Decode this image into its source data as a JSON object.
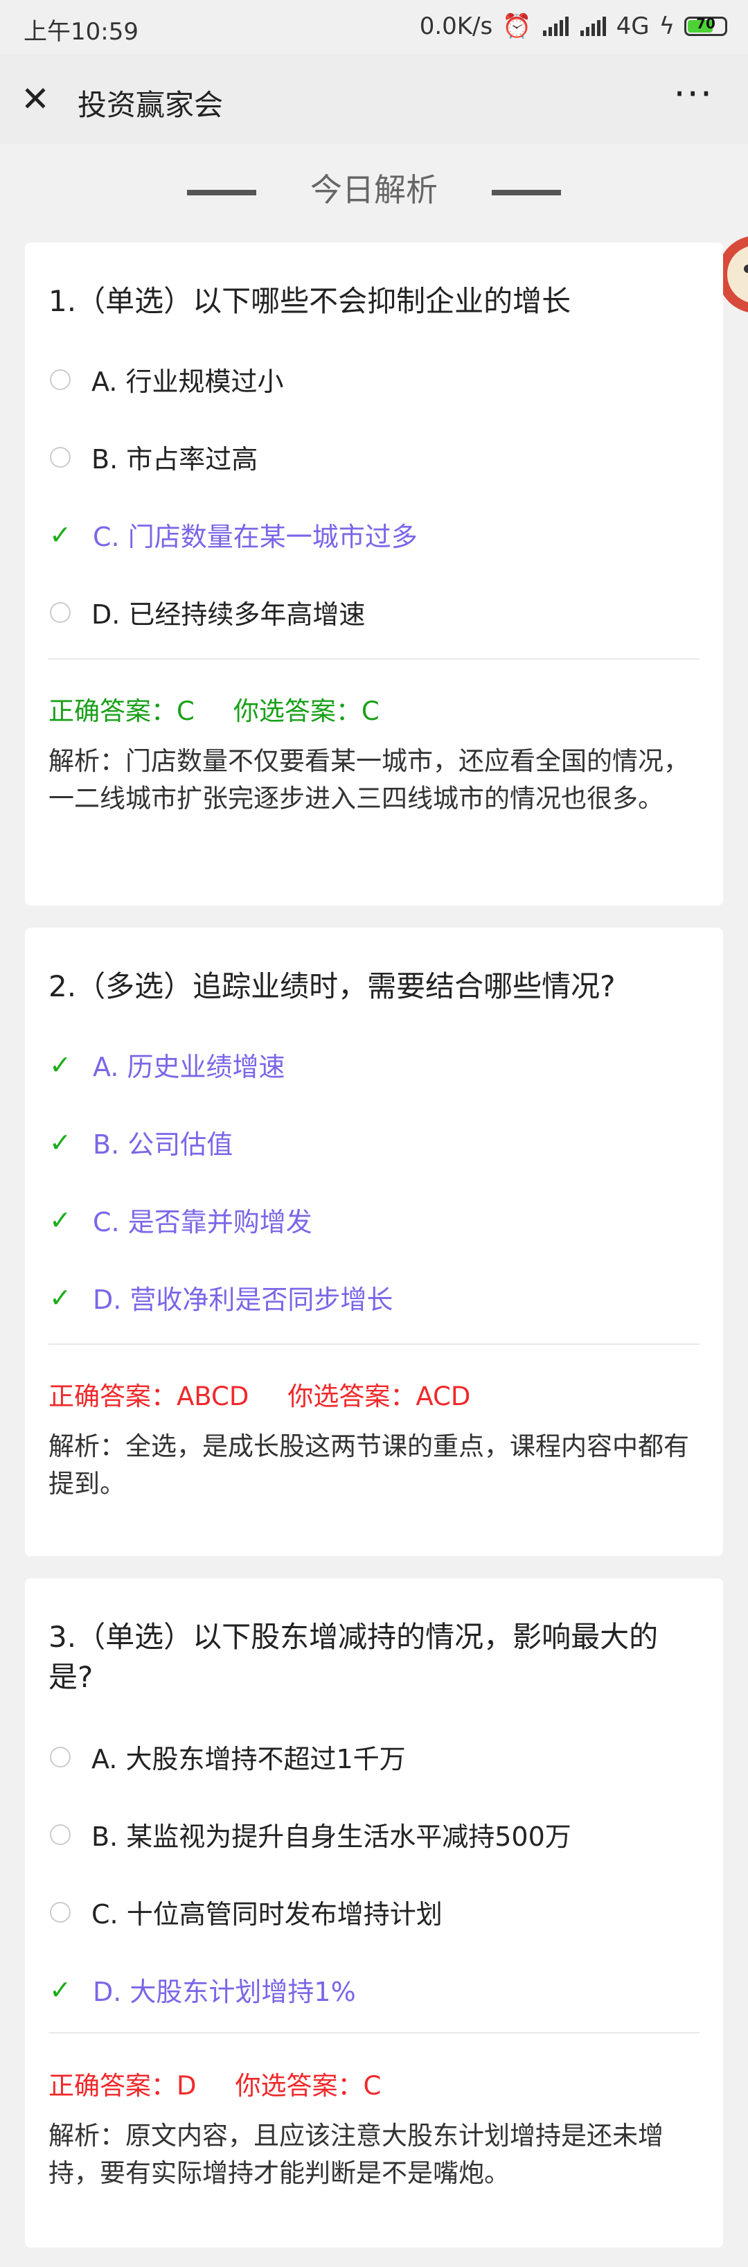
{
  "status_bar": {
    "time": "上午10:59",
    "network_speed": "0.0K/s",
    "network_type": "4G",
    "battery": "70",
    "battery_level": 0.7
  },
  "header": {
    "title": "投资赢家会",
    "more": "···"
  },
  "section_title": "今日解析",
  "questions": [
    {
      "title": "1.（单选）以下哪些不会抑制企业的增长",
      "options": [
        {
          "label": "A. 行业规模过小",
          "selected": false
        },
        {
          "label": "B. 市占率过高",
          "selected": false
        },
        {
          "label": "C. 门店数量在某一城市过多",
          "selected": true
        },
        {
          "label": "D. 已经持续多年高增速",
          "selected": false
        }
      ],
      "correct_answer": "正确答案：C",
      "your_answer": "你选答案：C",
      "result": "correct",
      "explanation": "解析：门店数量不仅要看某一城市，还应看全国的情况，一二线城市扩张完逐步进入三四线城市的情况也很多。"
    },
    {
      "title": "2.（多选）追踪业绩时，需要结合哪些情况?",
      "options": [
        {
          "label": "A. 历史业绩增速",
          "selected": true
        },
        {
          "label": "B. 公司估值",
          "selected": true
        },
        {
          "label": "C. 是否靠并购增发",
          "selected": true
        },
        {
          "label": "D. 营收净利是否同步增长",
          "selected": true
        }
      ],
      "correct_answer": "正确答案：ABCD",
      "your_answer": "你选答案：ACD",
      "result": "wrong",
      "explanation": "解析：全选，是成长股这两节课的重点，课程内容中都有提到。"
    },
    {
      "title": "3.（单选）以下股东增减持的情况，影响最大的是?",
      "options": [
        {
          "label": "A. 大股东增持不超过1千万",
          "selected": false
        },
        {
          "label": "B. 某监视为提升自身生活水平减持500万",
          "selected": false
        },
        {
          "label": "C. 十位高管同时发布增持计划",
          "selected": false
        },
        {
          "label": "D. 大股东计划增持1%",
          "selected": true
        }
      ],
      "correct_answer": "正确答案：D",
      "your_answer": "你选答案：C",
      "result": "wrong",
      "explanation": "解析：原文内容，且应该注意大股东计划增持是还未增持，要有实际增持才能判断是不是嘴炮。"
    }
  ]
}
